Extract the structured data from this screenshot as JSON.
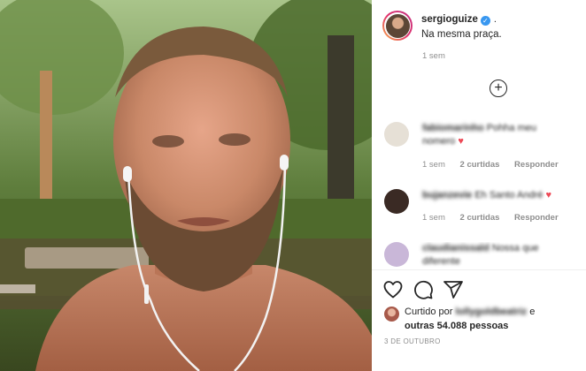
{
  "post": {
    "username": "sergioguize",
    "verified_mark": "✓",
    "dot": ".",
    "caption": "Na mesma praça.",
    "time_ago": "1 sem",
    "load_more_icon": "+"
  },
  "comments": [
    {
      "user": "fabiomarinho",
      "text_lines": [
        "Pohha meu",
        "nomero"
      ],
      "has_heart": true,
      "heart": "♥",
      "time": "1 sem",
      "likes": "2 curtidas",
      "reply": "Responder",
      "avatar_color": "#e6e0d6"
    },
    {
      "user": "bujanzevie",
      "text_lines": [
        "Eh Santo André"
      ],
      "has_heart": true,
      "heart": "♥",
      "time": "1 sem",
      "likes": "2 curtidas",
      "reply": "Responder",
      "avatar_color": "#3a2a24"
    },
    {
      "user": "claudianissald",
      "text_lines": [
        "Nossa que",
        "diferente"
      ],
      "has_heart": false,
      "avatar_color": "#c9b7d8"
    }
  ],
  "actions": {
    "like": "heart-icon",
    "comment": "comment-icon",
    "share": "share-icon"
  },
  "likes_summary": {
    "prefix": "Curtido por",
    "liker": "lollygoldbeatriz",
    "conjunction": "e",
    "others": "outras 54.088 pessoas"
  },
  "date": "3 DE OUTUBRO",
  "colors": {
    "verified": "#3897f0",
    "heart": "#ed4956",
    "secondary_text": "#8e8e8e"
  }
}
